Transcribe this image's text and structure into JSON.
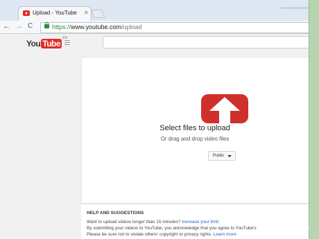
{
  "browser": {
    "tab_title": "Upload - YouTube",
    "tab_close": "×",
    "back_glyph": "←",
    "forward_glyph": "→",
    "reload_glyph": "C",
    "url_scheme": "https://",
    "url_host": "www.youtube.com",
    "url_path": "/upload"
  },
  "youtube": {
    "logo_you": "You",
    "logo_tube": "Tube",
    "logo_region": "EN",
    "guide_icon": "menu-icon"
  },
  "upload": {
    "title": "Select files to upload",
    "subtitle": "Or drag and drop video files",
    "privacy_value": "Public",
    "icon_color": "#d0302b"
  },
  "help": {
    "heading": "HELP AND SUGGESTIONS",
    "line1_text": "Want to upload videos longer than 15 minutes? ",
    "line1_link": "Increase your limit",
    "line2_text": "By submitting your videos to YouTube, you acknowledge that you agree to YouTube's",
    "line3_text": "Please be sure not to violate others' copyright or privacy rights. ",
    "line3_link": "Learn more"
  },
  "watermark": {
    "wiki": "wiki",
    "how": "How"
  }
}
